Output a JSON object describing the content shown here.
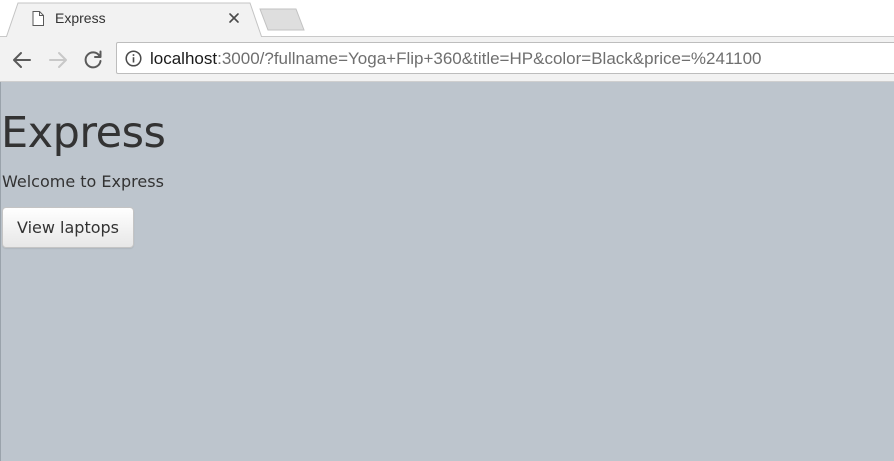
{
  "browser": {
    "tab": {
      "title": "Express",
      "icon": "page-icon",
      "close_icon": "close-icon"
    },
    "toolbar": {
      "back_icon": "arrow-left-icon",
      "forward_icon": "arrow-right-icon",
      "reload_icon": "reload-icon",
      "info_icon": "info-icon"
    },
    "address": {
      "host": "localhost",
      "rest": ":3000/?fullname=Yoga+Flip+360&title=HP&color=Black&price=%241100"
    }
  },
  "page": {
    "title": "Express",
    "subtitle": "Welcome to Express",
    "button_label": "View laptops",
    "background_color": "#bdc5cd",
    "text_color": "#333333"
  }
}
